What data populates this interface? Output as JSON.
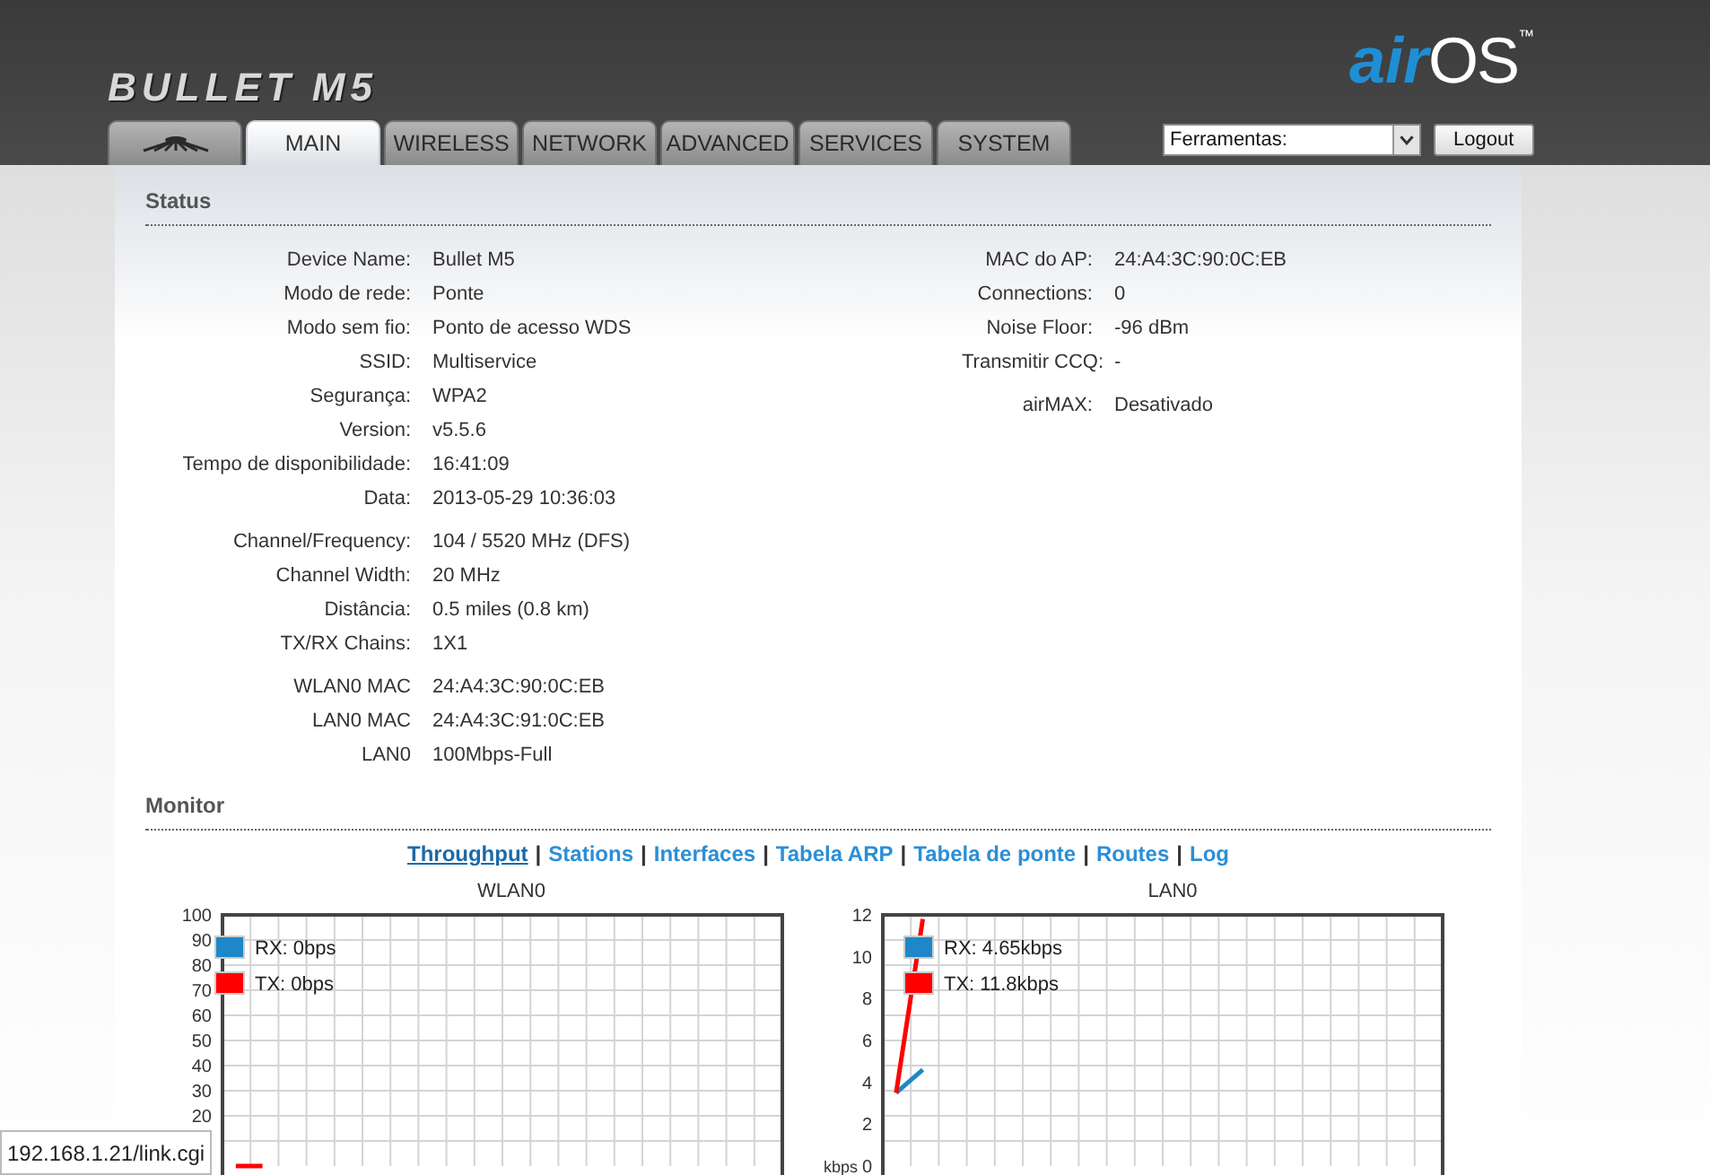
{
  "header": {
    "product": "BULLET M5",
    "os_prefix": "air",
    "os_name": "OS",
    "trademark": "™"
  },
  "tabs": [
    {
      "kind": "logo",
      "selected": false
    },
    {
      "kind": "text",
      "label": "MAIN",
      "selected": true
    },
    {
      "kind": "text",
      "label": "WIRELESS",
      "selected": false
    },
    {
      "kind": "text",
      "label": "NETWORK",
      "selected": false
    },
    {
      "kind": "text",
      "label": "ADVANCED",
      "selected": false
    },
    {
      "kind": "text",
      "label": "SERVICES",
      "selected": false
    },
    {
      "kind": "text",
      "label": "SYSTEM",
      "selected": false
    }
  ],
  "tools_select": {
    "value": "Ferramentas:"
  },
  "logout_button": "Logout",
  "status": {
    "title": "Status",
    "left_groups": [
      [
        {
          "label": "Device Name:",
          "value": "Bullet M5"
        },
        {
          "label": "Modo de rede:",
          "value": "Ponte"
        },
        {
          "label": "Modo sem fio:",
          "value": "Ponto de acesso WDS"
        },
        {
          "label": "SSID:",
          "value": "Multiservice"
        },
        {
          "label": "Segurança:",
          "value": "WPA2"
        },
        {
          "label": "Version:",
          "value": "v5.5.6"
        },
        {
          "label": "Tempo de disponibilidade:",
          "value": "16:41:09"
        },
        {
          "label": "Data:",
          "value": "2013-05-29 10:36:03"
        }
      ],
      [
        {
          "label": "Channel/Frequency:",
          "value": "104 / 5520 MHz (DFS)"
        },
        {
          "label": "Channel Width:",
          "value": "20 MHz"
        },
        {
          "label": "Distância:",
          "value": "0.5 miles (0.8 km)"
        },
        {
          "label": "TX/RX Chains:",
          "value": "1X1"
        }
      ],
      [
        {
          "label": "WLAN0 MAC",
          "value": "24:A4:3C:90:0C:EB"
        },
        {
          "label": "LAN0 MAC",
          "value": "24:A4:3C:91:0C:EB"
        },
        {
          "label": "LAN0",
          "value": "100Mbps-Full"
        }
      ]
    ],
    "right_groups": [
      [
        {
          "label": "MAC do AP:",
          "value": "24:A4:3C:90:0C:EB"
        },
        {
          "label": "Connections:",
          "value": "0"
        },
        {
          "label": "Noise Floor:",
          "value": "-96 dBm"
        },
        {
          "label": "Transmitir CCQ:",
          "value": "-"
        }
      ],
      [
        {
          "label": "airMAX:",
          "value": "Desativado"
        }
      ]
    ]
  },
  "monitor": {
    "title": "Monitor",
    "links": [
      {
        "label": "Throughput",
        "selected": true
      },
      {
        "label": "Stations",
        "selected": false
      },
      {
        "label": "Interfaces",
        "selected": false
      },
      {
        "label": "Tabela ARP",
        "selected": false
      },
      {
        "label": "Tabela de ponte",
        "selected": false
      },
      {
        "label": "Routes",
        "selected": false
      },
      {
        "label": "Log",
        "selected": false
      }
    ],
    "separator": "|",
    "charts": [
      {
        "chart_data": {
          "type": "line",
          "title": "WLAN0",
          "grid": true,
          "legend": true,
          "categories": [
            null,
            null,
            null,
            null,
            null,
            null,
            null,
            null,
            null,
            null,
            null,
            null,
            null,
            null,
            null,
            null,
            null,
            null,
            null,
            null,
            null
          ],
          "ylim": [
            0,
            100
          ],
          "yticks": [
            20,
            30,
            40,
            50,
            60,
            70,
            80,
            90,
            100
          ],
          "series": [
            {
              "name": "RX: 0bps",
              "color": "#1f87c9",
              "values": [
                null,
                null,
                null,
                null,
                null,
                null,
                null,
                null,
                null,
                null,
                null,
                null,
                null,
                null,
                null,
                null,
                null,
                null,
                null,
                null,
                null
              ]
            },
            {
              "name": "TX: 0bps",
              "color": "#ff0000",
              "values": [
                0,
                0,
                null,
                null,
                null,
                null,
                null,
                null,
                null,
                null,
                null,
                null,
                null,
                null,
                null,
                null,
                null,
                null,
                null,
                null,
                null
              ]
            }
          ]
        }
      },
      {
        "chart_data": {
          "type": "line",
          "title": "LAN0",
          "grid": true,
          "legend": true,
          "ylabel": "kbps",
          "categories": [
            null,
            null,
            null,
            null,
            null,
            null,
            null,
            null,
            null,
            null,
            null,
            null,
            null,
            null,
            null,
            null,
            null,
            null,
            null,
            null,
            null
          ],
          "ylim": [
            0,
            12
          ],
          "yticks": [
            0,
            2,
            4,
            6,
            8,
            10,
            12
          ],
          "series": [
            {
              "name": "RX: 4.65kbps",
              "color": "#1f87c9",
              "values": [
                3.5,
                4.6,
                null,
                null,
                null,
                null,
                null,
                null,
                null,
                null,
                null,
                null,
                null,
                null,
                null,
                null,
                null,
                null,
                null,
                null,
                null
              ]
            },
            {
              "name": "TX: 11.8kbps",
              "color": "#ff0000",
              "values": [
                3.5,
                11.8,
                null,
                null,
                null,
                null,
                null,
                null,
                null,
                null,
                null,
                null,
                null,
                null,
                null,
                null,
                null,
                null,
                null,
                null,
                null
              ]
            }
          ]
        }
      }
    ]
  },
  "status_bar": "192.168.1.21/link.cgi"
}
